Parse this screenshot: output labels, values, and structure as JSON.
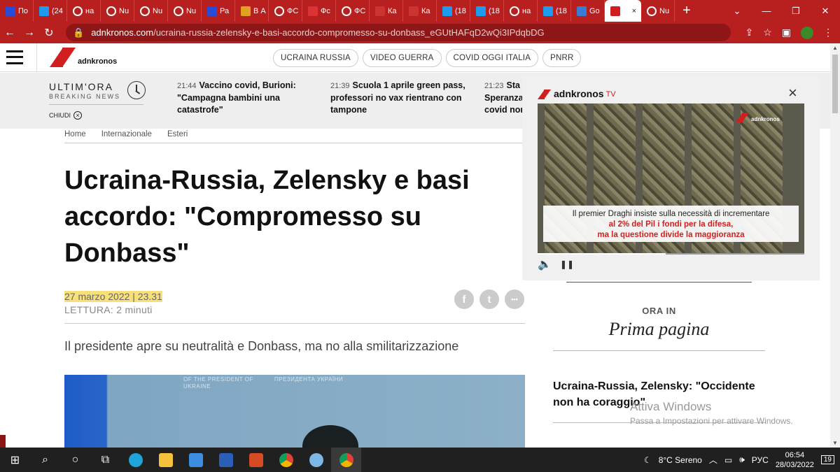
{
  "browser": {
    "tabs": [
      {
        "favicon": "iz",
        "title": "По",
        "color": "#2a4bd7"
      },
      {
        "favicon": "twitter-icon",
        "title": "(24",
        "color": "#1d9bf0"
      },
      {
        "favicon": "google-icon",
        "title": "на",
        "color": "#ffffff"
      },
      {
        "favicon": "chrome-icon",
        "title": "Nu",
        "color": "#ffffff"
      },
      {
        "favicon": "chrome-icon",
        "title": "Nu",
        "color": "#ffffff"
      },
      {
        "favicon": "chrome-icon",
        "title": "Nu",
        "color": "#ffffff"
      },
      {
        "favicon": "iz",
        "title": "Ра",
        "color": "#2a4bd7"
      },
      {
        "favicon": "grid-icon",
        "title": "В А",
        "color": "#e0a020"
      },
      {
        "favicon": "google-icon",
        "title": "ФС",
        "color": "#ffffff"
      },
      {
        "favicon": "u-icon",
        "title": "Фс",
        "color": "#d33"
      },
      {
        "favicon": "google-icon",
        "title": "ФС",
        "color": "#ffffff"
      },
      {
        "favicon": "ku-icon",
        "title": "Ка",
        "color": "#c33"
      },
      {
        "favicon": "ku-icon",
        "title": "Ка",
        "color": "#c33"
      },
      {
        "favicon": "twitter-icon",
        "title": "(18",
        "color": "#1d9bf0"
      },
      {
        "favicon": "twitter-icon",
        "title": "(18",
        "color": "#1d9bf0"
      },
      {
        "favicon": "google-icon",
        "title": "на",
        "color": "#ffffff"
      },
      {
        "favicon": "twitter-icon",
        "title": "(18",
        "color": "#1d9bf0"
      },
      {
        "favicon": "gb-icon",
        "title": "Go",
        "color": "#3a7bd5"
      }
    ],
    "active_tab": {
      "favicon": "adnkronos-icon",
      "close": "×"
    },
    "last_tab": {
      "favicon": "chrome-icon",
      "title": "Nu"
    },
    "new_tab": "+",
    "url_host": "adnkronos.com",
    "url_path": "/ucraina-russia-zelensky-e-basi-accordo-compromesso-su-donbass_eGUtHAFqD2wQi3IPdqbDG"
  },
  "site": {
    "logo_text": "adnkronos",
    "nav_pills": [
      "UCRAINA RUSSIA",
      "VIDEO GUERRA",
      "COVID OGGI ITALIA",
      "PNRR"
    ]
  },
  "breaking": {
    "title": "ULTIM'ORA",
    "subtitle": "BREAKING NEWS",
    "close_label": "CHIUDI",
    "items": [
      {
        "time": "21:44",
        "text": "Vaccino covid, Burioni: \"Campagna bambini una catastrofe\""
      },
      {
        "time": "21:39",
        "text": "Scuola 1 aprile green pass, professori no vax rientrano con tampone"
      },
      {
        "time": "21:23",
        "text": "Sta Speranza covid non"
      }
    ]
  },
  "article": {
    "breadcrumb": [
      "Home",
      "Internazionale",
      "Esteri"
    ],
    "title": "Ucraina-Russia, Zelensky e basi accordo: \"Compromesso su Donbass\"",
    "date": "27 marzo 2022 | 23.31",
    "reading": "LETTURA: 2 minuti",
    "subtitle": "Il presidente apre su neutralità e Donbass, ma no alla smilitarizzazione",
    "share": {
      "facebook": "f",
      "twitter": "t",
      "more": "•••"
    },
    "photo_text_left": "OF THE PRESIDENT OF UKRAINE",
    "photo_text_right": "ПРЕЗИДЕНТА УКРАЇНИ"
  },
  "tv": {
    "brand": "adnkronos",
    "tv_label": "TV",
    "close": "×",
    "caption_line1": "Il premier Draghi insiste sulla necessità di incrementare",
    "caption_line2": "al 2% del Pil i fondi per la difesa,",
    "caption_line3": "ma la questione divide la maggioranza",
    "watermark": "adnkronos",
    "progress": 0.48,
    "volume_icon": "🔈",
    "pause_icon": "❚❚"
  },
  "sidebar": {
    "ora_in": "ORA IN",
    "section": "Prima pagina",
    "headline": "Ucraina-Russia, Zelensky: \"Occidente non ha coraggio\""
  },
  "windows": {
    "activate_title": "Attiva Windows",
    "activate_sub": "Passa a Impostazioni per attivare Windows.",
    "weather": "8°C Sereno",
    "lang": "РУС",
    "time": "06:54",
    "date": "28/03/2022",
    "notifications": "19"
  }
}
